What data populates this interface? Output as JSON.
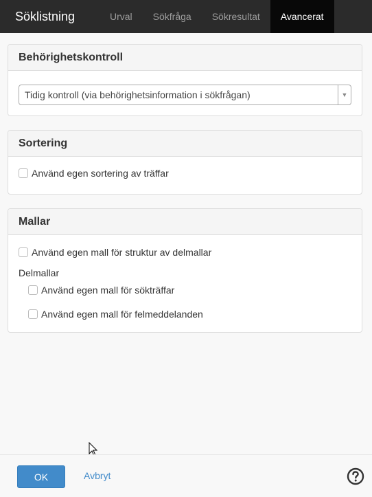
{
  "nav": {
    "brand": "Söklistning",
    "tabs": [
      {
        "label": "Urval"
      },
      {
        "label": "Sökfråga"
      },
      {
        "label": "Sökresultat"
      },
      {
        "label": "Avancerat"
      }
    ],
    "active_tab": "Avancerat"
  },
  "access_control": {
    "title": "Behörighetskontroll",
    "select_value": "Tidig kontroll (via behörighetsinformation i sökfrågan)"
  },
  "sorting": {
    "title": "Sortering",
    "custom_sort_label": "Använd egen sortering av träffar"
  },
  "templates": {
    "title": "Mallar",
    "structure_label": "Använd egen mall för struktur av delmallar",
    "subtemplates_label": "Delmallar",
    "hits_label": "Använd egen mall för sökträffar",
    "errors_label": "Använd egen mall för felmeddelanden"
  },
  "footer": {
    "ok_label": "OK",
    "cancel_label": "Avbryt"
  },
  "colors": {
    "navbar": "#2b2b2b",
    "active_tab": "#080808",
    "primary": "#428bca"
  },
  "icons": {
    "help": "help-circle-icon",
    "cursor": "mouse-pointer-icon"
  }
}
